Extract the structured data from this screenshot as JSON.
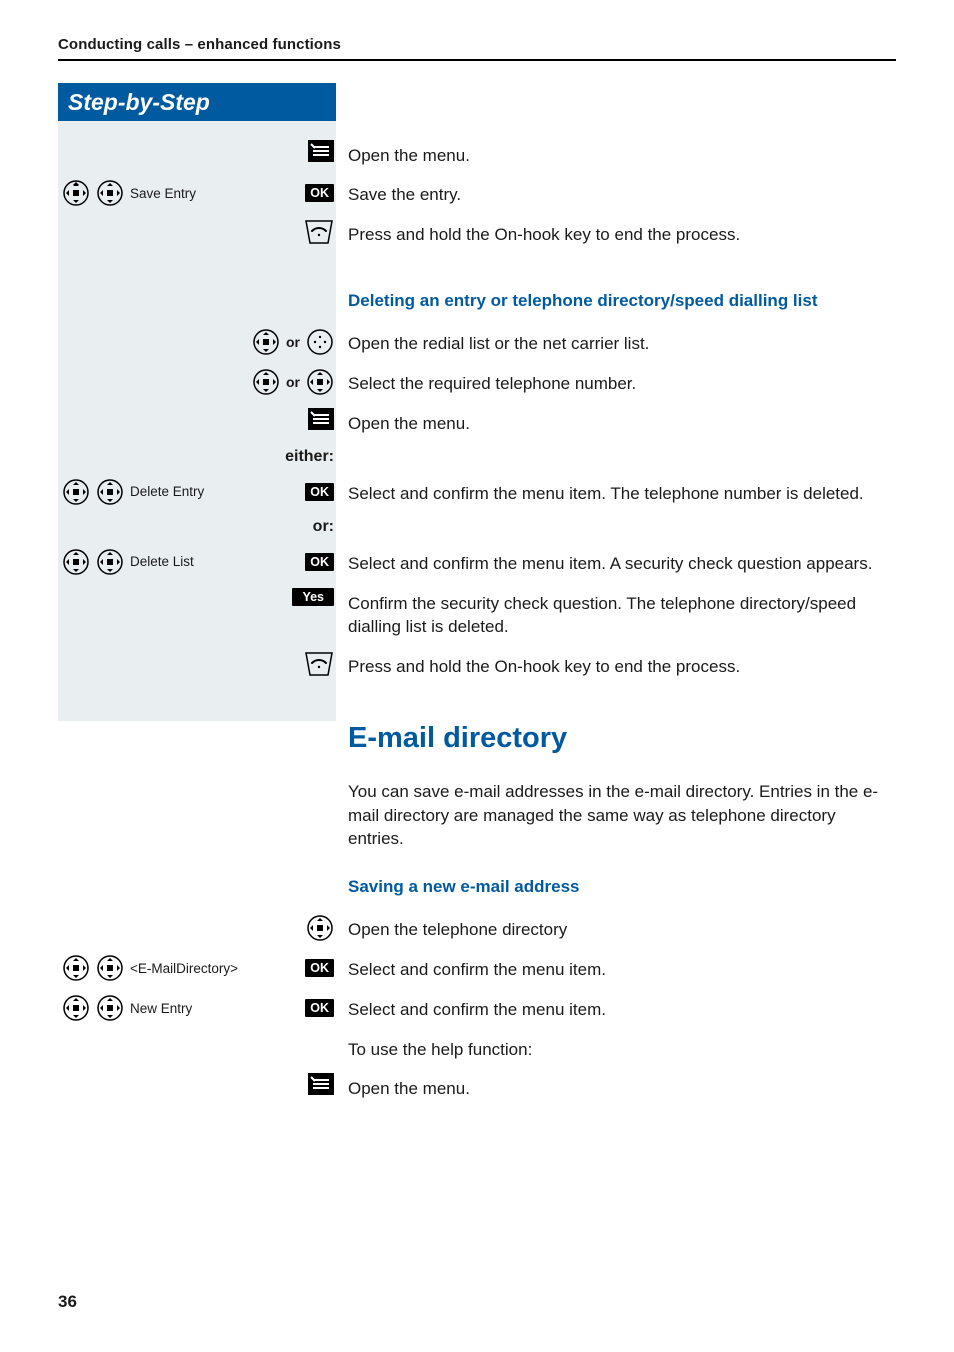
{
  "header_title": "Conducting calls – enhanced functions",
  "sidebar_title": "Step-by-Step",
  "page_number": "36",
  "labels": {
    "ok": "OK",
    "yes": "Yes",
    "or": "or",
    "either": "either:",
    "or_colon": "or:",
    "save_entry": "Save Entry",
    "delete_entry": "Delete Entry",
    "delete_list": "Delete List",
    "email_directory": "<E-MailDirectory>",
    "new_entry": "New Entry"
  },
  "headings": {
    "deleting": "Deleting an entry or telephone directory/speed dialling list",
    "email_directory": "E-mail directory",
    "saving_email": "Saving a new e-mail address"
  },
  "steps": {
    "open_menu": "Open the menu.",
    "save_entry": "Save the entry.",
    "end_process": "Press and hold the On-hook key to end the process.",
    "open_redial": "Open the redial list or the net carrier list.",
    "select_number": "Select the required telephone number.",
    "delete_entry": "Select and confirm the menu item. The telephone number is deleted.",
    "delete_list": "Select and confirm the menu item. A security check question appears.",
    "confirm_security": "Confirm the security check question. The telephone directory/speed dialling list is deleted.",
    "email_intro": "You can save e-mail addresses in the e-mail directory. Entries in the e-mail directory are managed the same way as telephone directory entries.",
    "open_directory": "Open the telephone directory",
    "select_confirm": "Select and confirm the menu item.",
    "help_func": "To use the help function:"
  }
}
